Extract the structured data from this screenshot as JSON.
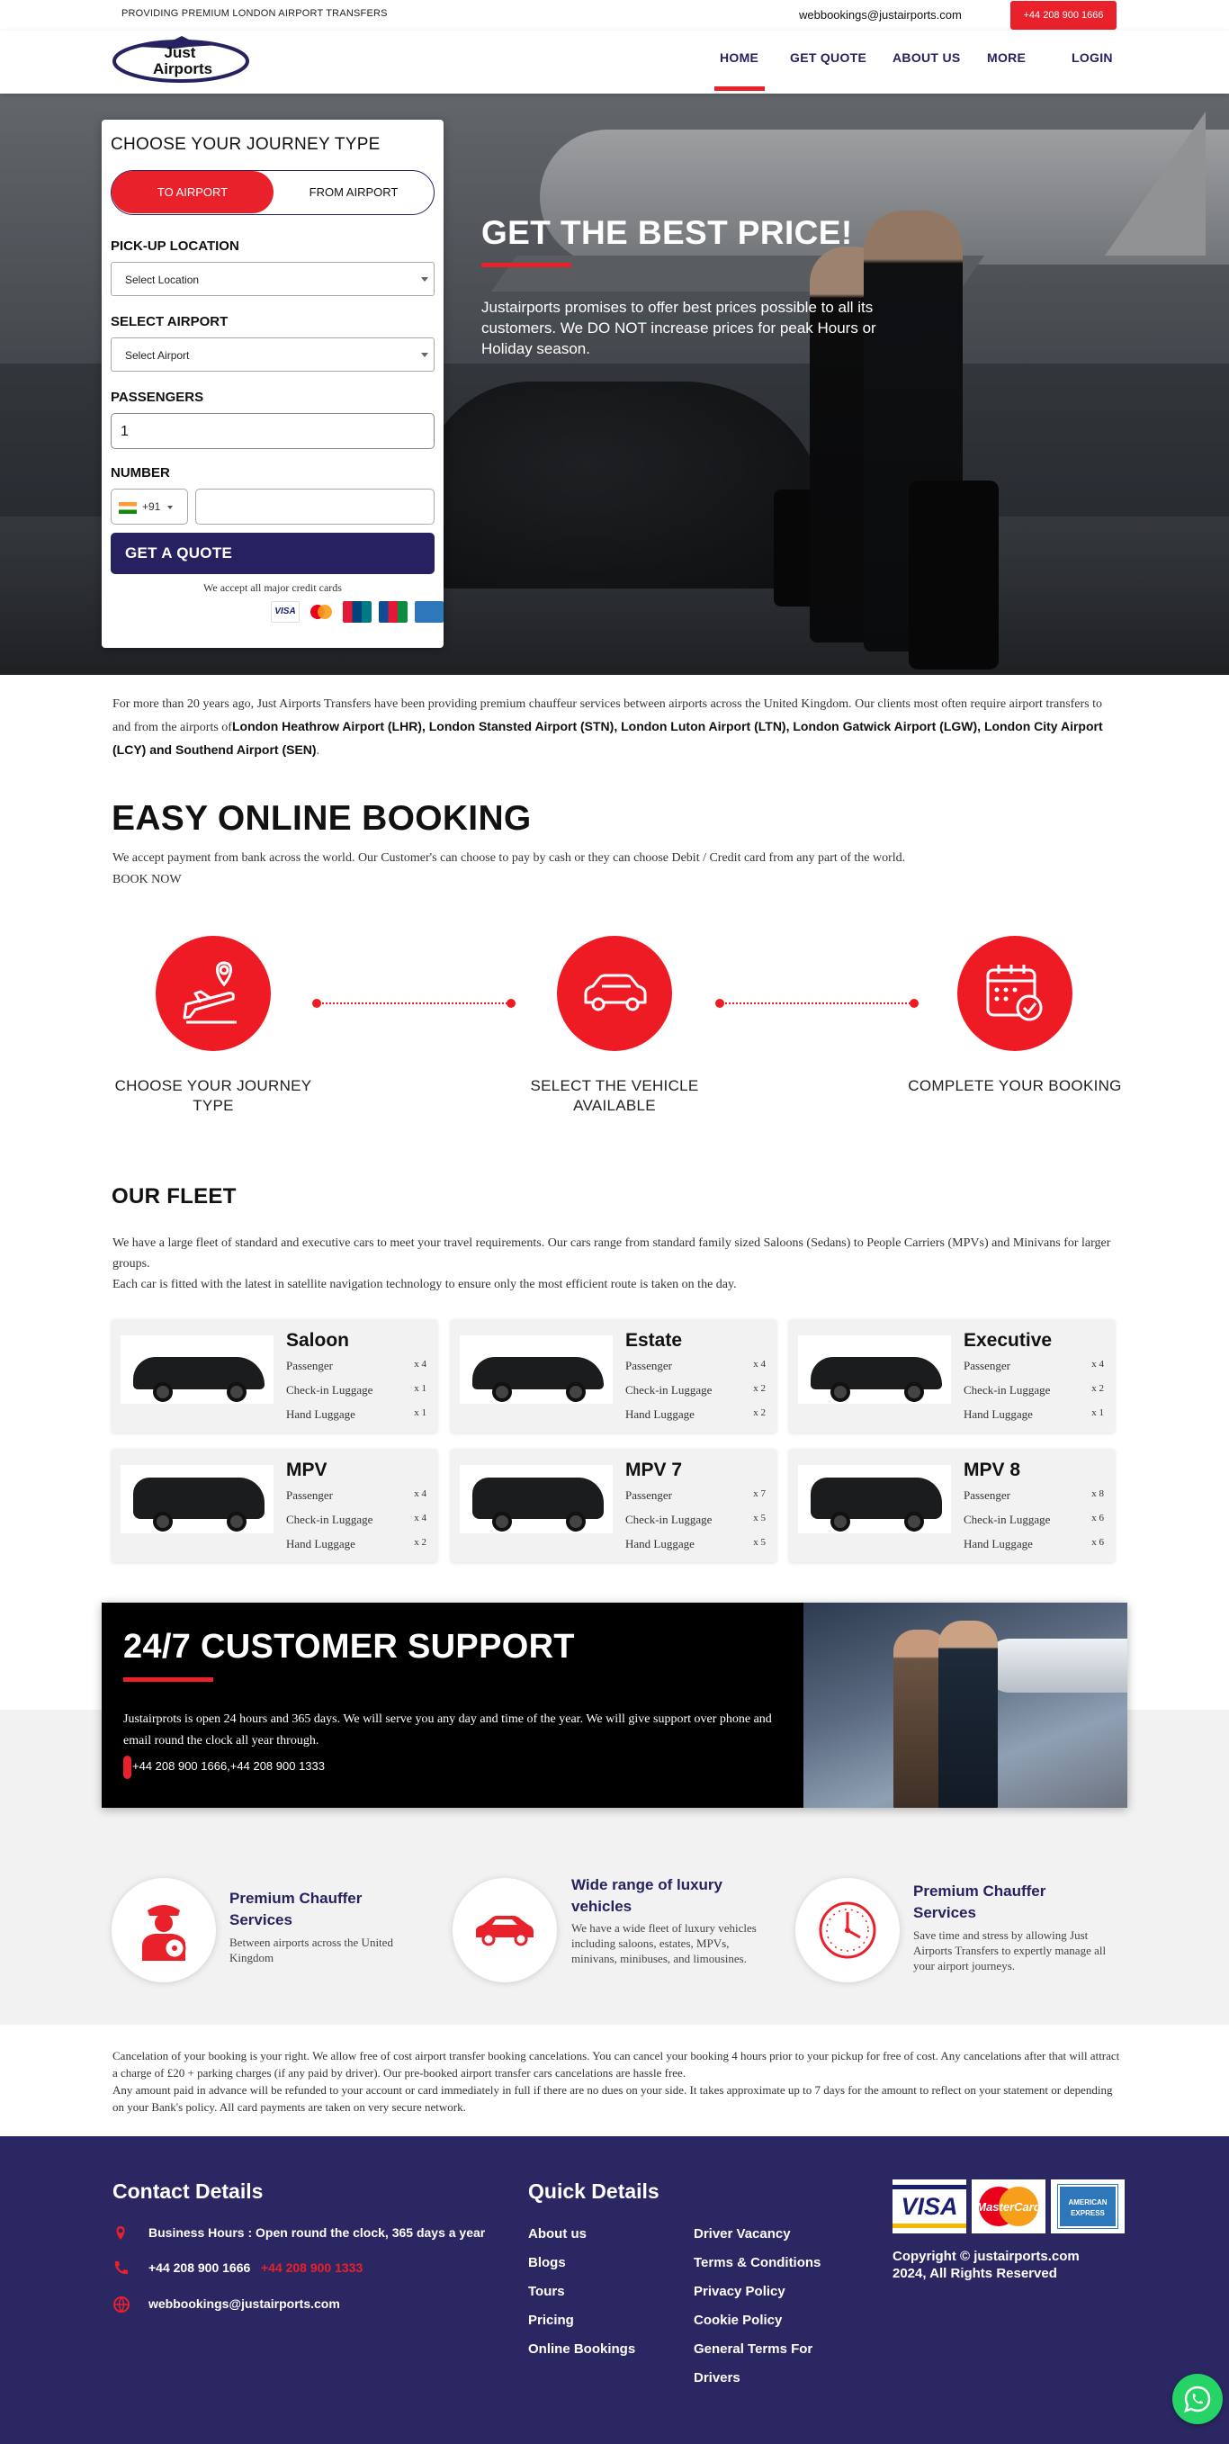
{
  "topbar": {
    "tagline": "PROVIDING PREMIUM LONDON AIRPORT TRANSFERS",
    "email": "webbookings@justairports.com",
    "phone": "+44 208 900 1666"
  },
  "header": {
    "logo_line1": "Just",
    "logo_line2": "Airports",
    "nav": [
      "HOME",
      "GET QUOTE",
      "ABOUT US",
      "MORE",
      "LOGIN"
    ],
    "active": "HOME"
  },
  "hero": {
    "title": "GET THE BEST PRICE!",
    "text": "Justairports promises to offer best prices possible to all its customers. We DO NOT increase prices for peak Hours or Holiday season."
  },
  "form": {
    "title": "CHOOSE YOUR JOURNEY TYPE",
    "toggle_to": "TO AIRPORT",
    "toggle_from": "FROM AIRPORT",
    "pickup_label": "PICK-UP LOCATION",
    "pickup_value": "Select Location",
    "airport_label": "SELECT AIRPORT",
    "airport_value": "Select Airport",
    "passengers_label": "PASSENGERS",
    "passengers_value": "1",
    "number_label": "NUMBER",
    "country_code": "+91",
    "submit": "GET A QUOTE",
    "cards_note": "We accept all major credit cards",
    "card_brands": [
      "VISA",
      "MasterCard",
      "UnionPay",
      "JCB",
      "AMEX"
    ]
  },
  "intro": {
    "text_start": "For more than 20 years ago, Just Airports Transfers have been providing premium chauffeur services between airports across the United Kingdom. Our clients most often require airport transfers to and from the airports of",
    "airports_bold": "London Heathrow Airport (LHR), London Stansted Airport (STN), London Luton Airport (LTN), London Gatwick Airport (LGW), London City Airport (LCY) and Southend Airport (SEN)",
    "text_end": "."
  },
  "easy": {
    "title": "EASY ONLINE BOOKING",
    "text": "We accept payment from bank across the world. Our Customer's can choose to pay by cash or they can choose Debit / Credit card from any part of the world.",
    "book_now": "BOOK NOW",
    "steps": [
      "CHOOSE YOUR JOURNEY TYPE",
      "SELECT THE VEHICLE AVAILABLE",
      "COMPLETE YOUR BOOKING"
    ],
    "step_icons": [
      "plane-location-icon",
      "car-icon",
      "calendar-check-icon"
    ]
  },
  "fleet": {
    "title": "OUR FLEET",
    "text1": "We have a large fleet of standard and executive cars to meet your travel requirements. Our cars range from standard family sized Saloons (Sedans) to People Carriers (MPVs) and Minivans for larger groups.",
    "text2": "Each car is fitted with the latest in satellite navigation technology to ensure only the most efficient route is taken on the day.",
    "row_labels": [
      "Passenger",
      "Check-in Luggage",
      "Hand Luggage"
    ],
    "cars": [
      {
        "name": "Saloon",
        "passenger": "x 4",
        "checkin": "x 1",
        "hand": "x 1"
      },
      {
        "name": "Estate",
        "passenger": "x 4",
        "checkin": "x 2",
        "hand": "x 2"
      },
      {
        "name": "Executive",
        "passenger": "x 4",
        "checkin": "x 2",
        "hand": "x 1"
      },
      {
        "name": "MPV",
        "passenger": "x 4",
        "checkin": "x 4",
        "hand": "x 2"
      },
      {
        "name": "MPV 7",
        "passenger": "x 7",
        "checkin": "x 5",
        "hand": "x 5"
      },
      {
        "name": "MPV 8",
        "passenger": "x 8",
        "checkin": "x 6",
        "hand": "x 6"
      }
    ]
  },
  "support": {
    "title": "24/7 CUSTOMER SUPPORT",
    "text": "Justairprots is open 24 hours and 365 days. We will serve you any day and time of the year. We will give support over phone and email round the clock all year through.",
    "phones": "+44 208 900 1666,+44 208 900 1333"
  },
  "features": [
    {
      "title": "Premium Chauffer Services",
      "text": "Between airports across the United Kingdom",
      "icon": "chauffeur-icon"
    },
    {
      "title": "Wide range of luxury vehicles",
      "text": "We have a wide fleet of luxury vehicles including saloons, estates, MPVs, minivans, minibuses, and limousines.",
      "icon": "luxury-car-icon"
    },
    {
      "title": "Premium Chauffer Services",
      "text": "Save time and stress by allowing Just Airports Transfers to expertly manage all your airport journeys.",
      "icon": "clock-icon"
    }
  ],
  "cancellation": {
    "p1": "Cancelation of your booking is your right. We allow free of cost airport transfer booking cancelations. You can cancel your booking 4 hours prior to your pickup for free of cost. Any cancelations after that will attract a charge of £20 + parking charges (if any paid by driver). Our pre-booked airport transfer cars cancelations are hassle free.",
    "p2": "Any amount paid in advance will be refunded to your account or card immediately in full if there are no dues on your side. It takes approximate up to 7 days for the amount to reflect on your statement or depending on your Bank's policy. All card payments are taken on very secure network."
  },
  "footer": {
    "contact_title": "Contact Details",
    "hours": "Business Hours : Open round the clock, 365 days a year",
    "phone1": "+44 208 900 1666",
    "phone2": "+44 208 900 1333",
    "email": "webbookings@justairports.com",
    "quick_title": "Quick Details",
    "links_col1": [
      "About us",
      "Blogs",
      "Tours",
      "Pricing",
      "Online Bookings"
    ],
    "links_col2": [
      "Driver Vacancy",
      "Terms & Conditions",
      "Privacy Policy",
      "Cookie Policy",
      "General Terms For",
      "Drivers"
    ],
    "payment_brands": [
      "VISA",
      "MasterCard",
      "AMERICAN EXPRESS"
    ],
    "copyright_line1": "Copyright © justairports.com",
    "copyright_line2": "2024, All Rights Reserved",
    "colors": {
      "navy": "#2b2762",
      "red": "#e8212b",
      "form_button": "#262261"
    }
  }
}
